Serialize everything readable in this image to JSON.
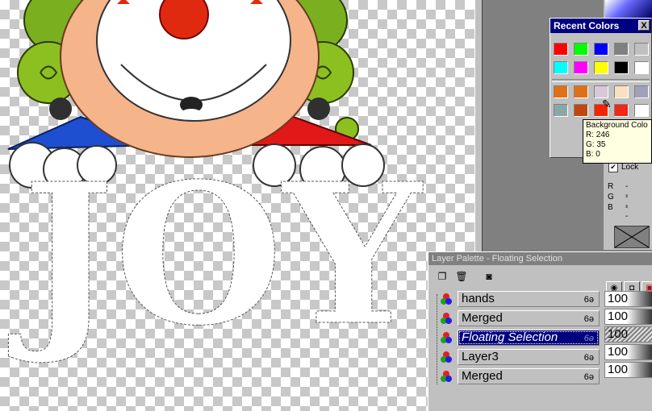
{
  "canvas": {
    "artwork_text": "JOY"
  },
  "recent_colors": {
    "title": "Recent Colors",
    "close_label": "X",
    "row1": [
      "#ff0000",
      "#00ff00",
      "#0000ff",
      "#808080",
      "#c0c0c0"
    ],
    "row2": [
      "#00ffff",
      "#ff00ff",
      "#ffff00",
      "#000000",
      "#ffffff"
    ],
    "row3": [
      "#e07018",
      "#e07018",
      "#d8c8d8",
      "#f8e0c0",
      "#a0a0b8"
    ],
    "row4": [
      "#8aa8a8",
      "#c04810",
      "#f62300",
      "#f02818",
      "#ffffff"
    ]
  },
  "tooltip": {
    "title": "Background Colo",
    "r": "R: 246",
    "g": "G: 35",
    "b": "B: 0"
  },
  "lock_panel": {
    "lock_label": "Lock",
    "lock_check": "✔",
    "r_label": "R",
    "g_label": "G",
    "b_label": "B",
    "r_value": "--",
    "g_value": "--",
    "b_value": "--"
  },
  "layer_palette": {
    "title": "Layer Palette - Floating Selection",
    "layers": [
      {
        "name": "hands",
        "opacity": "100",
        "selected": false
      },
      {
        "name": "Merged",
        "opacity": "100",
        "selected": false
      },
      {
        "name": "Floating Selection",
        "opacity": "100",
        "selected": true
      },
      {
        "name": "Layer3",
        "opacity": "100",
        "selected": false
      },
      {
        "name": "Merged",
        "opacity": "100",
        "selected": false
      }
    ],
    "visibility_glyph": "6ə"
  }
}
